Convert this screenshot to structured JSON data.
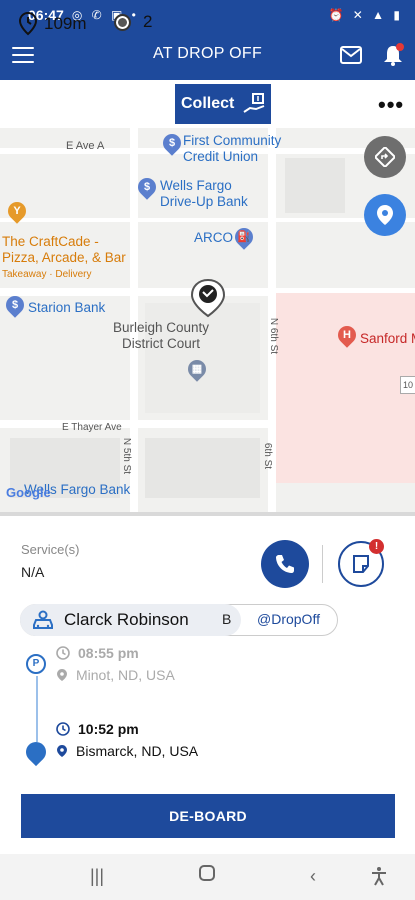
{
  "status_bar": {
    "time": "06:47"
  },
  "header": {
    "title": "AT DROP OFF"
  },
  "info_bar": {
    "distance": "109m",
    "stops": "2",
    "collect_label": "Collect"
  },
  "map": {
    "labels": {
      "e_ave_a": "E Ave A",
      "first_community": "First Community\nCredit Union",
      "wells_fargo_drive_up": "Wells Fargo\nDrive-Up Bank",
      "arco": "ARCO",
      "craftcade": "The CraftCade -\nPizza, Arcade, & Bar",
      "craftcade_sub": "Takeaway · Delivery",
      "starion": "Starion Bank",
      "burleigh": "Burleigh County\nDistrict Court",
      "sanford": "Sanford M",
      "thayer": "E Thayer Ave",
      "n6th_a": "N 6th St",
      "n6th_b": "6th St",
      "n5th": "N 5th St",
      "wells_fargo_bank": "Wells Fargo Bank",
      "google": "Google",
      "route_num": "10"
    }
  },
  "trip": {
    "services_label": "Service(s)",
    "services_value": "N/A",
    "note_badge": "!",
    "passenger_name": "Clarck Robinson",
    "passenger_code": "B",
    "passenger_tag": "@DropOff",
    "pickup": {
      "marker": "P",
      "time": "08:55 pm",
      "address": "Minot, ND, USA"
    },
    "dropoff": {
      "time": "10:52 pm",
      "address": "Bismarck, ND, USA"
    },
    "action_label": "DE-BOARD"
  },
  "colors": {
    "primary": "#1e4a9c",
    "accent_blue": "#2b6fc4",
    "alert_red": "#d32f2f"
  }
}
